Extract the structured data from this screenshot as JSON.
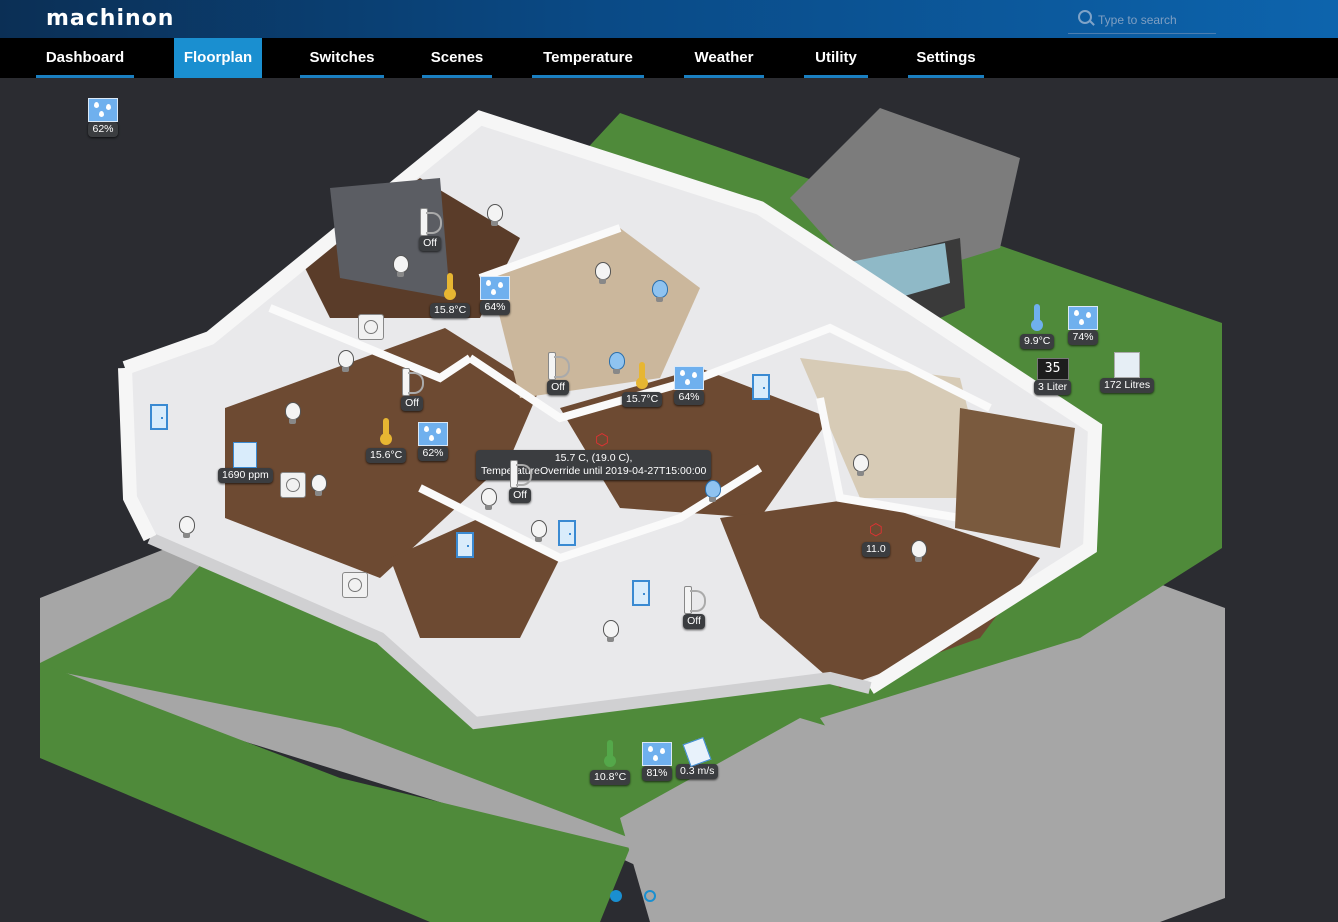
{
  "app": {
    "logo_text": "machinon"
  },
  "search": {
    "placeholder": "Type to search"
  },
  "nav": {
    "tabs": [
      {
        "label": "Dashboard"
      },
      {
        "label": "Floorplan"
      },
      {
        "label": "Switches"
      },
      {
        "label": "Scenes"
      },
      {
        "label": "Temperature"
      },
      {
        "label": "Weather"
      },
      {
        "label": "Utility"
      },
      {
        "label": "Settings"
      }
    ],
    "active": "Floorplan"
  },
  "devices": {
    "outside_top_left_humidity": "62%",
    "bedroom_switch": "Off",
    "bedroom_temp": "15.8°C",
    "bedroom_humidity": "64%",
    "hall_switch": "Off",
    "kitchen_switch": "Off",
    "kitchen_temp": "15.7°C",
    "kitchen_humidity": "64%",
    "living_temp": "15.6°C",
    "living_humidity": "62%",
    "living_co2": "1690 ppm",
    "center_switch": "Off",
    "entrance_switch": "Off",
    "office_heating": "11.0",
    "garden_temp": "9.9°C",
    "garden_humidity": "74%",
    "garden_rain": "3 Liter",
    "garden_water": "172 Litres",
    "outdoor_temp": "10.8°C",
    "outdoor_humidity": "81%",
    "outdoor_wind": "0.3 m/s",
    "rain_counter": "35"
  },
  "tooltip": {
    "line1": "15.7 C, (19.0 C),",
    "line2": "TemperatureOverride until 2019-04-27T15:00:00"
  },
  "colors": {
    "header_start": "#0b2f55",
    "header_end": "#0d64ad",
    "nav_bg": "#000000",
    "tab_active": "#1a8fd0",
    "tab_underline": "#1a7fc0",
    "page_bg": "#2b2c31",
    "grass": "#4f8a3a"
  }
}
